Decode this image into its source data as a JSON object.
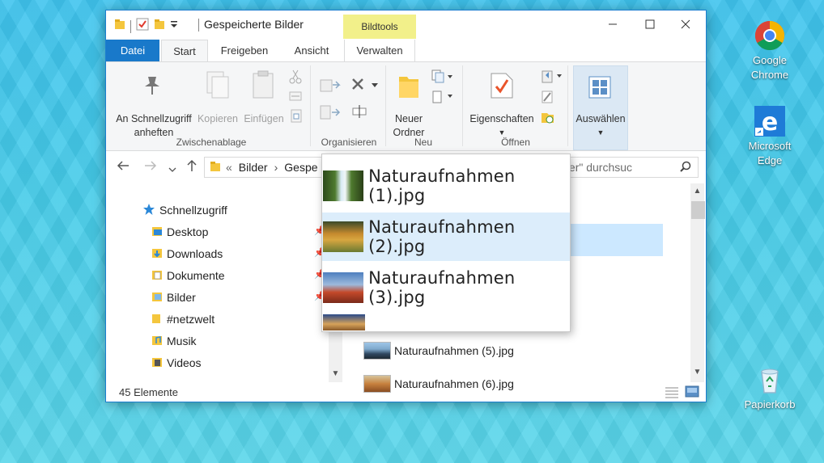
{
  "desktop": {
    "icons": [
      {
        "label_line1": "Google",
        "label_line2": "Chrome"
      },
      {
        "label_line1": "Microsoft",
        "label_line2": "Edge"
      },
      {
        "label_line1": "Papierkorb",
        "label_line2": ""
      }
    ]
  },
  "window": {
    "title": "Gespeicherte Bilder",
    "context_tab_group": "Bildtools",
    "tabs": [
      "Datei",
      "Start",
      "Freigeben",
      "Ansicht",
      "Verwalten"
    ],
    "help_symbol": "?"
  },
  "ribbon": {
    "pin_label_line1": "An Schnellzugriff",
    "pin_label_line2": "anheften",
    "copy_label": "Kopieren",
    "paste_label": "Einfügen",
    "group_clipboard": "Zwischenablage",
    "group_organize": "Organisieren",
    "new_folder_line1": "Neuer",
    "new_folder_line2": "Ordner",
    "group_new": "Neu",
    "properties_label": "Eigenschaften",
    "group_open": "Öffnen",
    "select_label": "Auswählen"
  },
  "addressbar": {
    "chevron": "«",
    "crumb1": "Bilder",
    "crumb_sep": "›",
    "crumb2": "Gespe",
    "search_text": "te Bilder\" durchsuc"
  },
  "navpane": {
    "items": [
      {
        "label": "Schnellzugriff"
      },
      {
        "label": "Desktop"
      },
      {
        "label": "Downloads"
      },
      {
        "label": "Dokumente"
      },
      {
        "label": "Bilder"
      },
      {
        "label": "#netzwelt"
      },
      {
        "label": "Musik"
      },
      {
        "label": "Videos"
      }
    ]
  },
  "files": {
    "visible_rows": [
      "Naturaufnahmen (5).jpg",
      "Naturaufnahmen (6).jpg"
    ]
  },
  "popup": {
    "items": [
      "Naturaufnahmen (1).jpg",
      "Naturaufnahmen (2).jpg",
      "Naturaufnahmen (3).jpg"
    ]
  },
  "status": {
    "count": "45 Elemente"
  },
  "colors": {
    "accent": "#1979ca",
    "selection": "#cce8ff",
    "context_tab": "#f2f08a"
  }
}
